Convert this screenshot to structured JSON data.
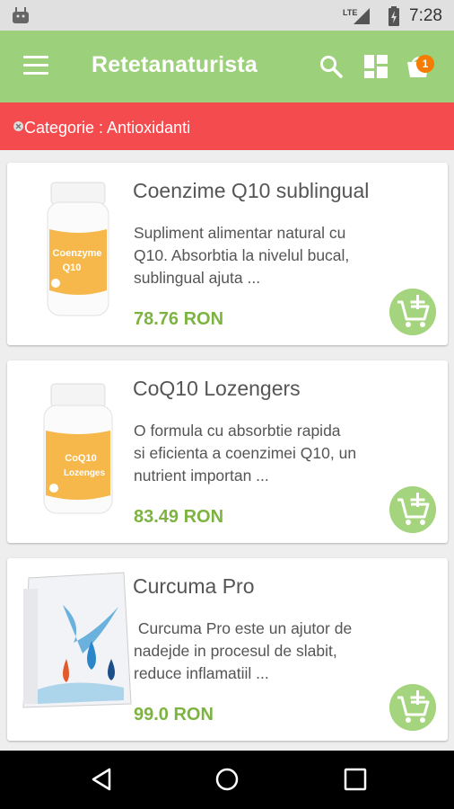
{
  "status": {
    "network": "LTE",
    "time": "7:28"
  },
  "app_bar": {
    "title": "Retetanaturista",
    "cart_count": "1",
    "icons": [
      "menu-icon",
      "search-icon",
      "grid-icon",
      "cart-icon"
    ]
  },
  "category": {
    "label": "Categorie : Antioxidanti"
  },
  "products": [
    {
      "name": "Coenzime Q10 sublingual",
      "desc_lines": [
        "Supliment alimentar natural cu",
        "Q10. Absorbtia la nivelul bucal,",
        "sublingual ajuta ..."
      ],
      "price": "78.76 RON",
      "label_lines": [
        "Coenzyme",
        "Q10"
      ]
    },
    {
      "name": "CoQ10 Lozengers",
      "desc_lines": [
        "O formula cu absorbtie rapida",
        "si eficienta a coenzimei Q10, un",
        "nutrient importan ..."
      ],
      "price": "83.49 RON",
      "label_lines": [
        "CoQ10",
        "Lozenges"
      ]
    },
    {
      "name": "Curcuma Pro",
      "desc_lines": [
        " Curcuma Pro este un ajutor de",
        "nadejde in procesul de slabit,",
        "reduce inflamatiil ..."
      ],
      "price": "99.0 RON"
    }
  ],
  "colors": {
    "app_bar": "#9dd07a",
    "category_bar": "#f44b4f",
    "price": "#7db441",
    "badge": "#f57c00"
  }
}
